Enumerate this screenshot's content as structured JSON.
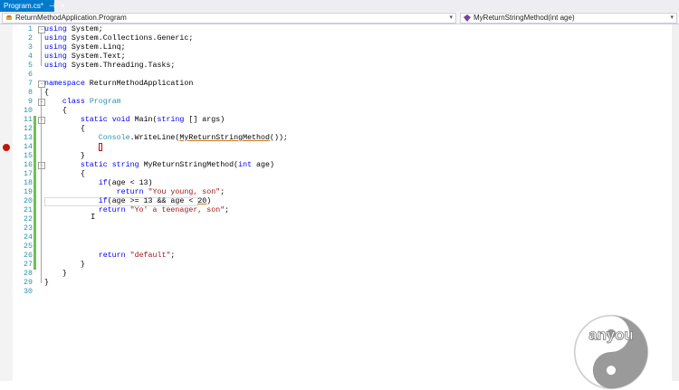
{
  "tab": {
    "title": "Program.cs*",
    "pin": "⊣",
    "close": "×"
  },
  "nav": {
    "left_label": "ReturnMethodApplication.Program",
    "right_label": "MyReturnStringMethod(int age)",
    "chevron": "▾"
  },
  "code_lines": [
    {
      "n": "1",
      "fold": "−",
      "segs": [
        [
          "kw",
          "using"
        ],
        [
          "",
          "System;"
        ]
      ]
    },
    {
      "n": "2",
      "segs": [
        [
          "kw",
          "using"
        ],
        [
          "",
          "System.Collections.Generic;"
        ]
      ]
    },
    {
      "n": "3",
      "segs": [
        [
          "kw",
          "using"
        ],
        [
          "",
          "System.Linq;"
        ]
      ]
    },
    {
      "n": "4",
      "segs": [
        [
          "kw",
          "using"
        ],
        [
          "",
          "System.Text;"
        ]
      ]
    },
    {
      "n": "5",
      "segs": [
        [
          "kw",
          "using"
        ],
        [
          "",
          "System.Threading.Tasks;"
        ]
      ]
    },
    {
      "n": "6",
      "segs": []
    },
    {
      "n": "7",
      "fold": "−",
      "segs": [
        [
          "kw",
          "namespace"
        ],
        [
          "",
          "ReturnMethodApplication"
        ]
      ]
    },
    {
      "n": "8",
      "segs": [
        [
          "",
          "{"
        ]
      ]
    },
    {
      "n": "9",
      "fold": "−",
      "segs": [
        [
          "",
          "    "
        ],
        [
          "kw",
          "class"
        ],
        [
          "ty",
          "Program"
        ]
      ]
    },
    {
      "n": "10",
      "segs": [
        [
          "",
          "    {"
        ]
      ]
    },
    {
      "n": "11",
      "fold": "−",
      "segs": [
        [
          "",
          "        "
        ],
        [
          "kw",
          "static"
        ],
        [
          "kw",
          "void"
        ],
        [
          "",
          "Main("
        ],
        [
          "kw",
          "string"
        ],
        [
          "",
          "[] args)"
        ]
      ]
    },
    {
      "n": "12",
      "segs": [
        [
          "",
          "        {"
        ]
      ]
    },
    {
      "n": "13",
      "segs": [
        [
          "",
          "            "
        ],
        [
          "ty",
          "Console"
        ],
        [
          "",
          ".WriteLine("
        ],
        [
          "ref",
          "MyReturnStringMethod"
        ],
        [
          "",
          "());"
        ]
      ]
    },
    {
      "n": "14",
      "segs": [
        [
          "",
          "            "
        ],
        [
          "caret",
          ""
        ]
      ]
    },
    {
      "n": "15",
      "segs": [
        [
          "",
          "        }"
        ]
      ]
    },
    {
      "n": "16",
      "fold": "−",
      "segs": [
        [
          "",
          "        "
        ],
        [
          "kw",
          "static"
        ],
        [
          "kw",
          "string"
        ],
        [
          "",
          "MyReturnStringMethod("
        ],
        [
          "kw",
          "int"
        ],
        [
          "",
          "age)"
        ]
      ]
    },
    {
      "n": "17",
      "segs": [
        [
          "",
          "        {"
        ]
      ]
    },
    {
      "n": "18",
      "segs": [
        [
          "",
          "            "
        ],
        [
          "kw",
          "if"
        ],
        [
          "",
          "(age < 13)"
        ]
      ]
    },
    {
      "n": "19",
      "segs": [
        [
          "",
          "                "
        ],
        [
          "kw",
          "return"
        ],
        [
          "st",
          "\"You young, son\""
        ],
        [
          "",
          ";"
        ]
      ]
    },
    {
      "n": "20",
      "segs": [
        [
          "",
          "            "
        ],
        [
          "kw",
          "if"
        ],
        [
          "",
          "(age >= 13 && age < "
        ],
        [
          "ref",
          "20"
        ],
        [
          "",
          ")"
        ]
      ]
    },
    {
      "n": "21",
      "segs": [
        [
          "",
          "            "
        ],
        [
          "kw",
          "return"
        ],
        [
          "st",
          "\"Yo' a teenager, son\""
        ],
        [
          "",
          ";"
        ]
      ]
    },
    {
      "n": "22",
      "segs": []
    },
    {
      "n": "23",
      "segs": []
    },
    {
      "n": "24",
      "segs": []
    },
    {
      "n": "25",
      "segs": []
    },
    {
      "n": "26",
      "segs": [
        [
          "",
          "            "
        ],
        [
          "kw",
          "return"
        ],
        [
          "st",
          "\"default\""
        ],
        [
          "",
          ";"
        ]
      ]
    },
    {
      "n": "27",
      "segs": [
        [
          "",
          "        }"
        ]
      ]
    },
    {
      "n": "28",
      "segs": [
        [
          "",
          "    }"
        ]
      ]
    },
    {
      "n": "29",
      "segs": [
        [
          "",
          "}"
        ]
      ]
    },
    {
      "n": "30",
      "segs": []
    }
  ],
  "changed_lines": [
    11,
    12,
    13,
    14,
    15,
    16,
    17,
    18,
    19,
    20,
    21,
    22,
    23,
    24,
    25,
    26,
    27
  ],
  "breakpoint_line": 14,
  "current_line": 20,
  "logo": {
    "text": "anyou",
    "icon": "yin-yang-icon"
  },
  "colors": {
    "accent": "#007acc",
    "keyword": "#0000ff",
    "type": "#2b91af",
    "string": "#a31515",
    "breakpoint": "#c1150c",
    "changed": "#6ec255"
  }
}
